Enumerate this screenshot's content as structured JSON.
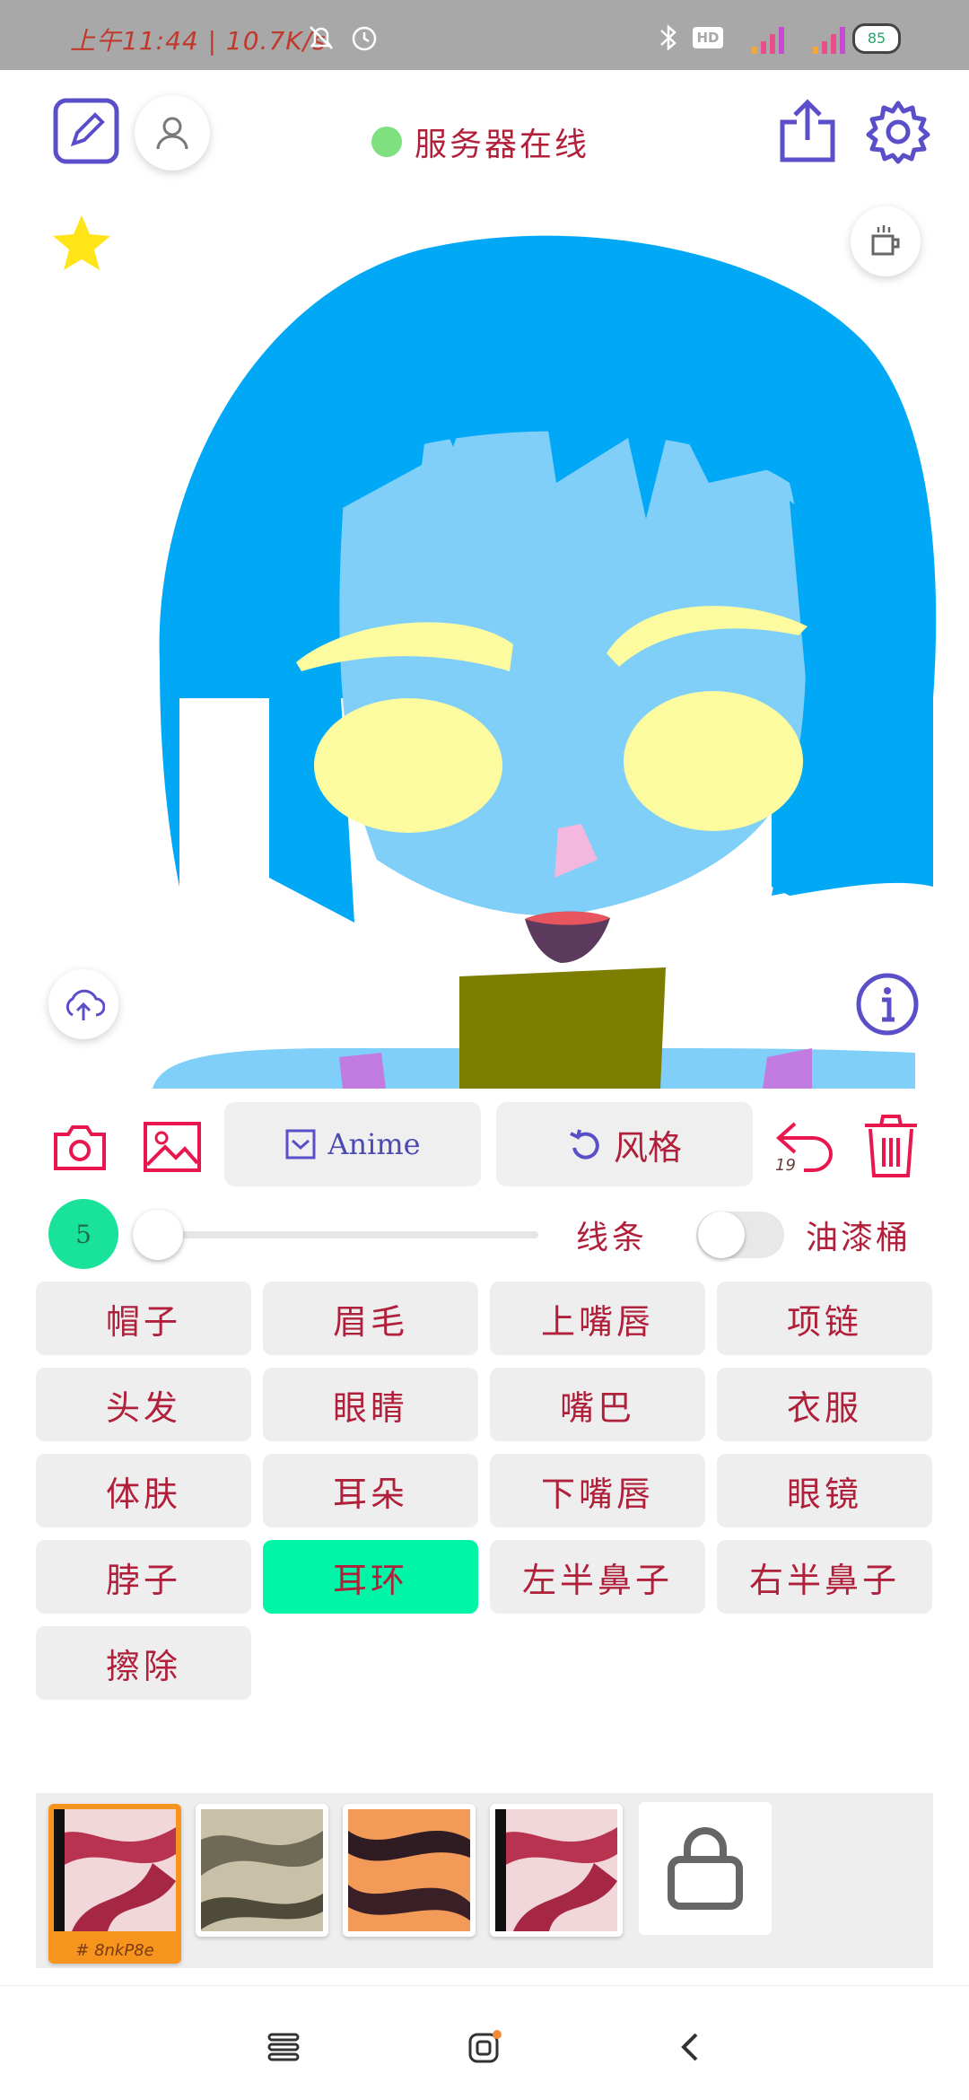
{
  "status_bar": {
    "time_speed": "上午11:44 | 10.7K/s",
    "battery": "85"
  },
  "header": {
    "server_status": "服务器在线"
  },
  "toolbar": {
    "style_model": "Anime",
    "style_button": "风格",
    "undo_count": "19"
  },
  "brush": {
    "size": "5",
    "slider_fraction": 0,
    "line_label": "线条",
    "paint_bucket_label": "油漆桶",
    "paint_bucket_on": false
  },
  "parts": [
    {
      "label": "帽子",
      "active": false
    },
    {
      "label": "眉毛",
      "active": false
    },
    {
      "label": "上嘴唇",
      "active": false
    },
    {
      "label": "项链",
      "active": false
    },
    {
      "label": "头发",
      "active": false
    },
    {
      "label": "眼睛",
      "active": false
    },
    {
      "label": "嘴巴",
      "active": false
    },
    {
      "label": "衣服",
      "active": false
    },
    {
      "label": "体肤",
      "active": false
    },
    {
      "label": "耳朵",
      "active": false
    },
    {
      "label": "下嘴唇",
      "active": false
    },
    {
      "label": "眼镜",
      "active": false
    },
    {
      "label": "脖子",
      "active": false
    },
    {
      "label": "耳环",
      "active": true
    },
    {
      "label": "左半鼻子",
      "active": false
    },
    {
      "label": "右半鼻子",
      "active": false
    },
    {
      "label": "擦除",
      "active": false
    }
  ],
  "thumbnails": {
    "selected_code": "# 8nkP8e"
  },
  "colors": {
    "accent_red": "#e8184f",
    "accent_purple": "#5b4fc9",
    "active_part": "#00f5a6",
    "hair": "#00a8f5",
    "skin": "#7fcff8",
    "eyes": "#fdfba0",
    "neck": "#7d7d00"
  },
  "icons": {
    "edit": "edit-square-icon",
    "profile": "user-icon",
    "share": "share-icon",
    "settings": "gear-icon",
    "favorite": "star-icon",
    "coffee": "coffee-cup-icon",
    "upload": "cloud-upload-icon",
    "info": "info-icon",
    "camera": "camera-icon",
    "gallery": "image-icon",
    "undo": "undo-icon",
    "delete": "trash-icon",
    "lock": "lock-icon"
  }
}
